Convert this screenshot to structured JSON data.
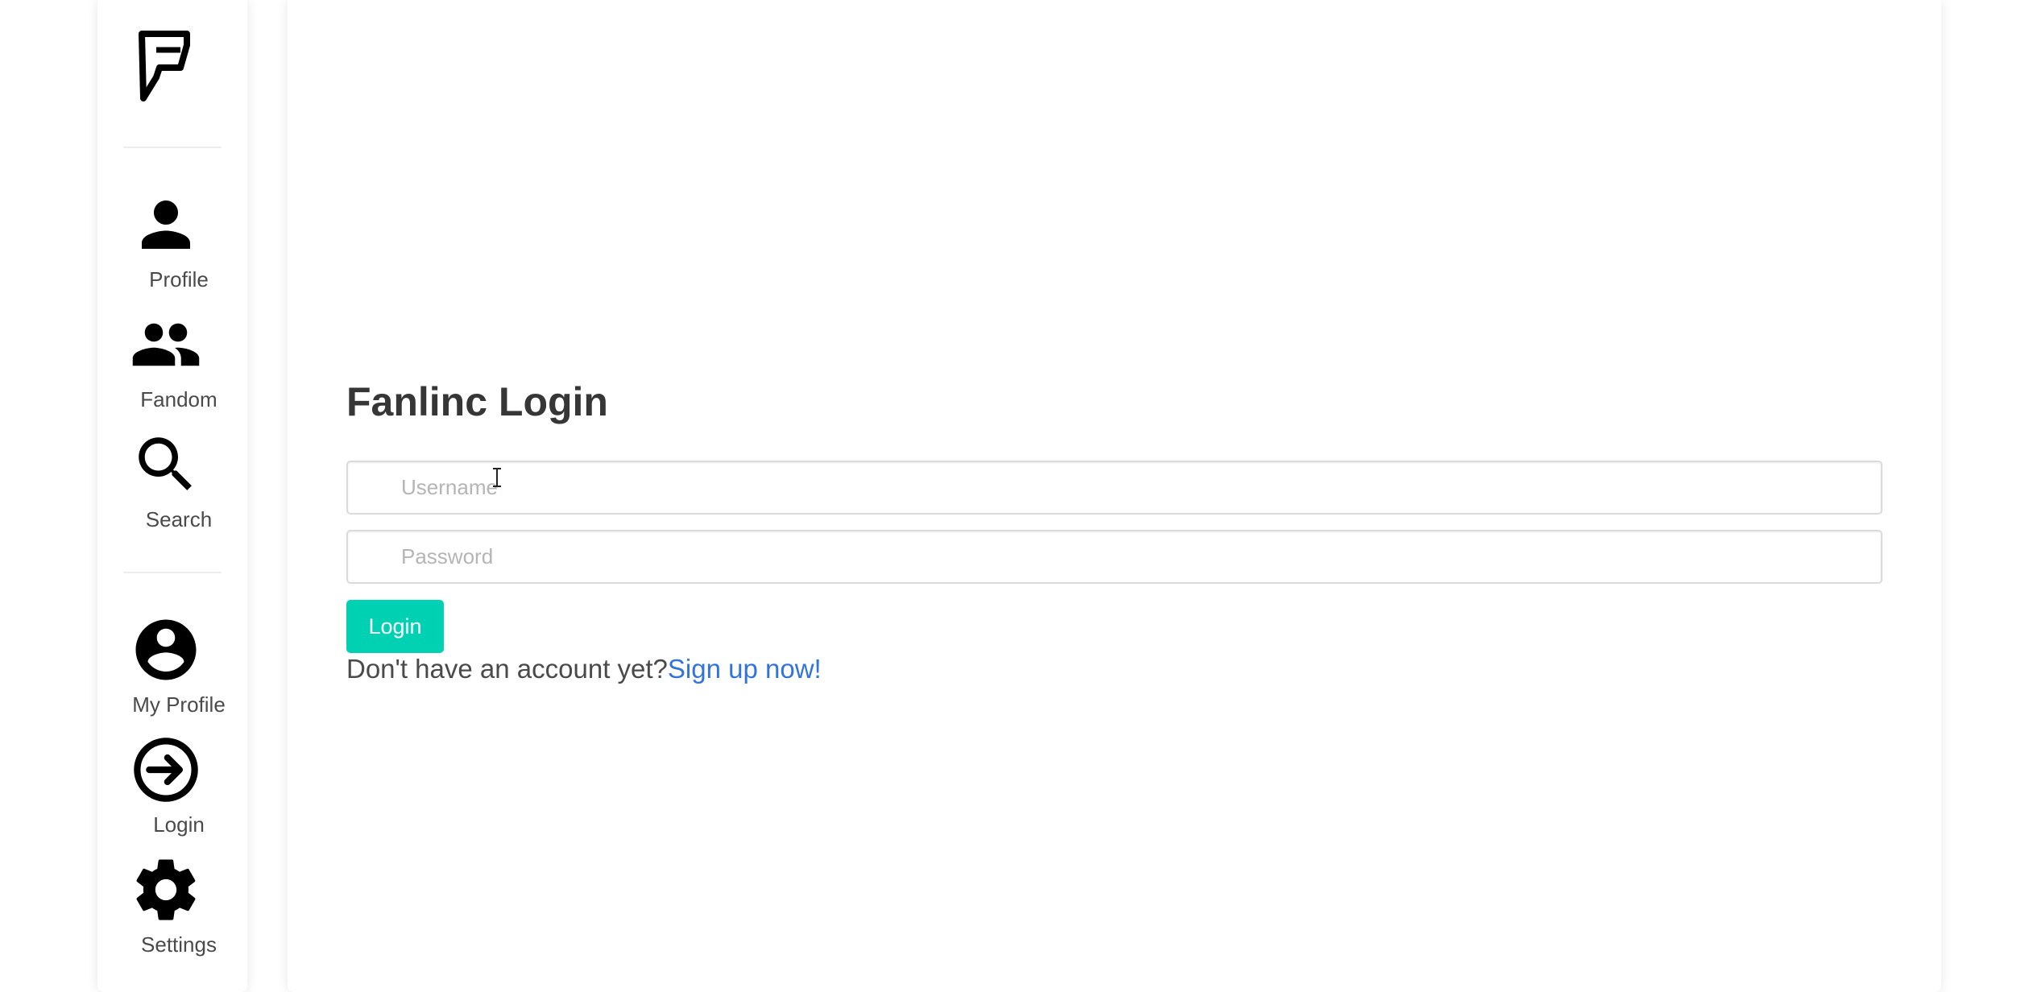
{
  "sidebar": {
    "logo_icon": "fanlinc-f-logo",
    "nav_top": [
      {
        "label": "Profile",
        "icon": "person-icon"
      },
      {
        "label": "Fandom",
        "icon": "people-icon"
      },
      {
        "label": "Search",
        "icon": "search-icon"
      }
    ],
    "nav_bottom": [
      {
        "label": "My Profile",
        "icon": "account-circle-icon"
      },
      {
        "label": "Login",
        "icon": "login-icon"
      },
      {
        "label": "Settings",
        "icon": "gear-icon"
      }
    ]
  },
  "main": {
    "title": "Fanlinc Login",
    "username_placeholder": "Username",
    "username_value": "",
    "password_placeholder": "Password",
    "password_value": "",
    "login_button": "Login",
    "signup_prompt": "Don't have an account yet?",
    "signup_link": "Sign up now!"
  },
  "colors": {
    "primary": "#00d1b2",
    "link": "#3273dc",
    "text": "#363636"
  }
}
